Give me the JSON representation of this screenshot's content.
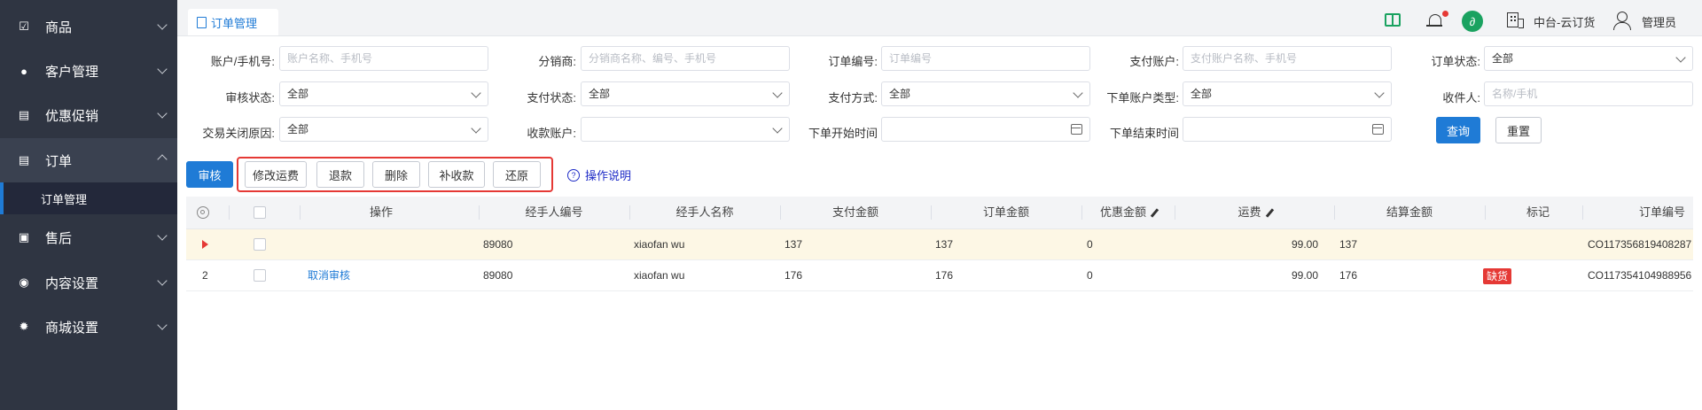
{
  "sidebar": {
    "items": [
      {
        "label": "商品",
        "icon": "box-check-icon"
      },
      {
        "label": "客户管理",
        "icon": "user-icon"
      },
      {
        "label": "优惠促销",
        "icon": "document-icon"
      },
      {
        "label": "订单",
        "icon": "document-icon"
      },
      {
        "label": "售后",
        "icon": "clipboard-icon"
      },
      {
        "label": "内容设置",
        "icon": "eye-icon"
      },
      {
        "label": "商城设置",
        "icon": "gear-icon"
      }
    ],
    "sub_item": "订单管理"
  },
  "tabs": [
    {
      "label": "订单管理"
    }
  ],
  "header": {
    "org": "中台-云订货",
    "user": "管理员"
  },
  "filters": {
    "account": {
      "label": "账户/手机号:",
      "placeholder": "账户名称、手机号"
    },
    "distributor": {
      "label": "分销商:",
      "placeholder": "分销商名称、编号、手机号"
    },
    "order_no": {
      "label": "订单编号:",
      "placeholder": "订单编号"
    },
    "pay_account": {
      "label": "支付账户:",
      "placeholder": "支付账户名称、手机号"
    },
    "order_status": {
      "label": "订单状态:",
      "value": "全部"
    },
    "audit_status": {
      "label": "审核状态:",
      "value": "全部"
    },
    "pay_status": {
      "label": "支付状态:",
      "value": "全部"
    },
    "pay_method": {
      "label": "支付方式:",
      "value": "全部"
    },
    "account_type": {
      "label": "下单账户类型:",
      "value": "全部"
    },
    "receiver": {
      "label": "收件人:",
      "placeholder": "名称/手机"
    },
    "close_reason": {
      "label": "交易关闭原因:",
      "value": "全部"
    },
    "collect_account": {
      "label": "收款账户:",
      "value": ""
    },
    "start_time": {
      "label": "下单开始时间",
      "value": ""
    },
    "end_time": {
      "label": "下单结束时间",
      "value": ""
    },
    "query_btn": "查询",
    "reset_btn": "重置"
  },
  "actions": {
    "audit": "审核",
    "modify_freight": "修改运费",
    "refund": "退款",
    "delete": "删除",
    "supplement": "补收款",
    "restore": "还原",
    "help": "操作说明"
  },
  "table": {
    "columns": [
      "操作",
      "经手人编号",
      "经手人名称",
      "支付金额",
      "订单金额",
      "优惠金额",
      "运费",
      "结算金额",
      "标记",
      "订单编号"
    ],
    "rows": [
      {
        "index": "",
        "action": "",
        "handler_no": "89080",
        "handler_name": "xiaofan wu",
        "pay_amount": "137",
        "order_amount": "137",
        "discount": "0",
        "freight": "99.00",
        "settle": "137",
        "mark": "",
        "order_no": "CO117356819408287"
      },
      {
        "index": "2",
        "action": "取消审核",
        "handler_no": "89080",
        "handler_name": "xiaofan wu",
        "pay_amount": "176",
        "order_amount": "176",
        "discount": "0",
        "freight": "99.00",
        "settle": "176",
        "mark": "缺货",
        "order_no": "CO117354104988956"
      }
    ]
  },
  "colors": {
    "sidebar_bg": "#2f3542",
    "primary": "#1f7bd6",
    "highlight_row": "#fdf7e5",
    "danger": "#e53935",
    "wechat": "#1aa260"
  }
}
